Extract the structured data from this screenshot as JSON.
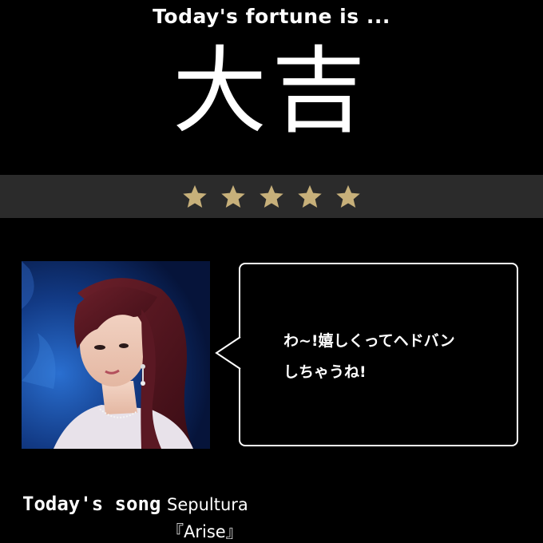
{
  "header": {
    "intro": "Today's fortune is ..."
  },
  "fortune": {
    "result": "大吉",
    "rating": 5,
    "rating_max": 5,
    "star_color": "#c7b07a",
    "band_color": "#2b2b2b"
  },
  "message": {
    "text": "わ~!嬉しくってヘドバン\nしちゃうね!"
  },
  "song": {
    "label": "Today's song",
    "artist": "Sepultura",
    "title": "『Arise』"
  }
}
